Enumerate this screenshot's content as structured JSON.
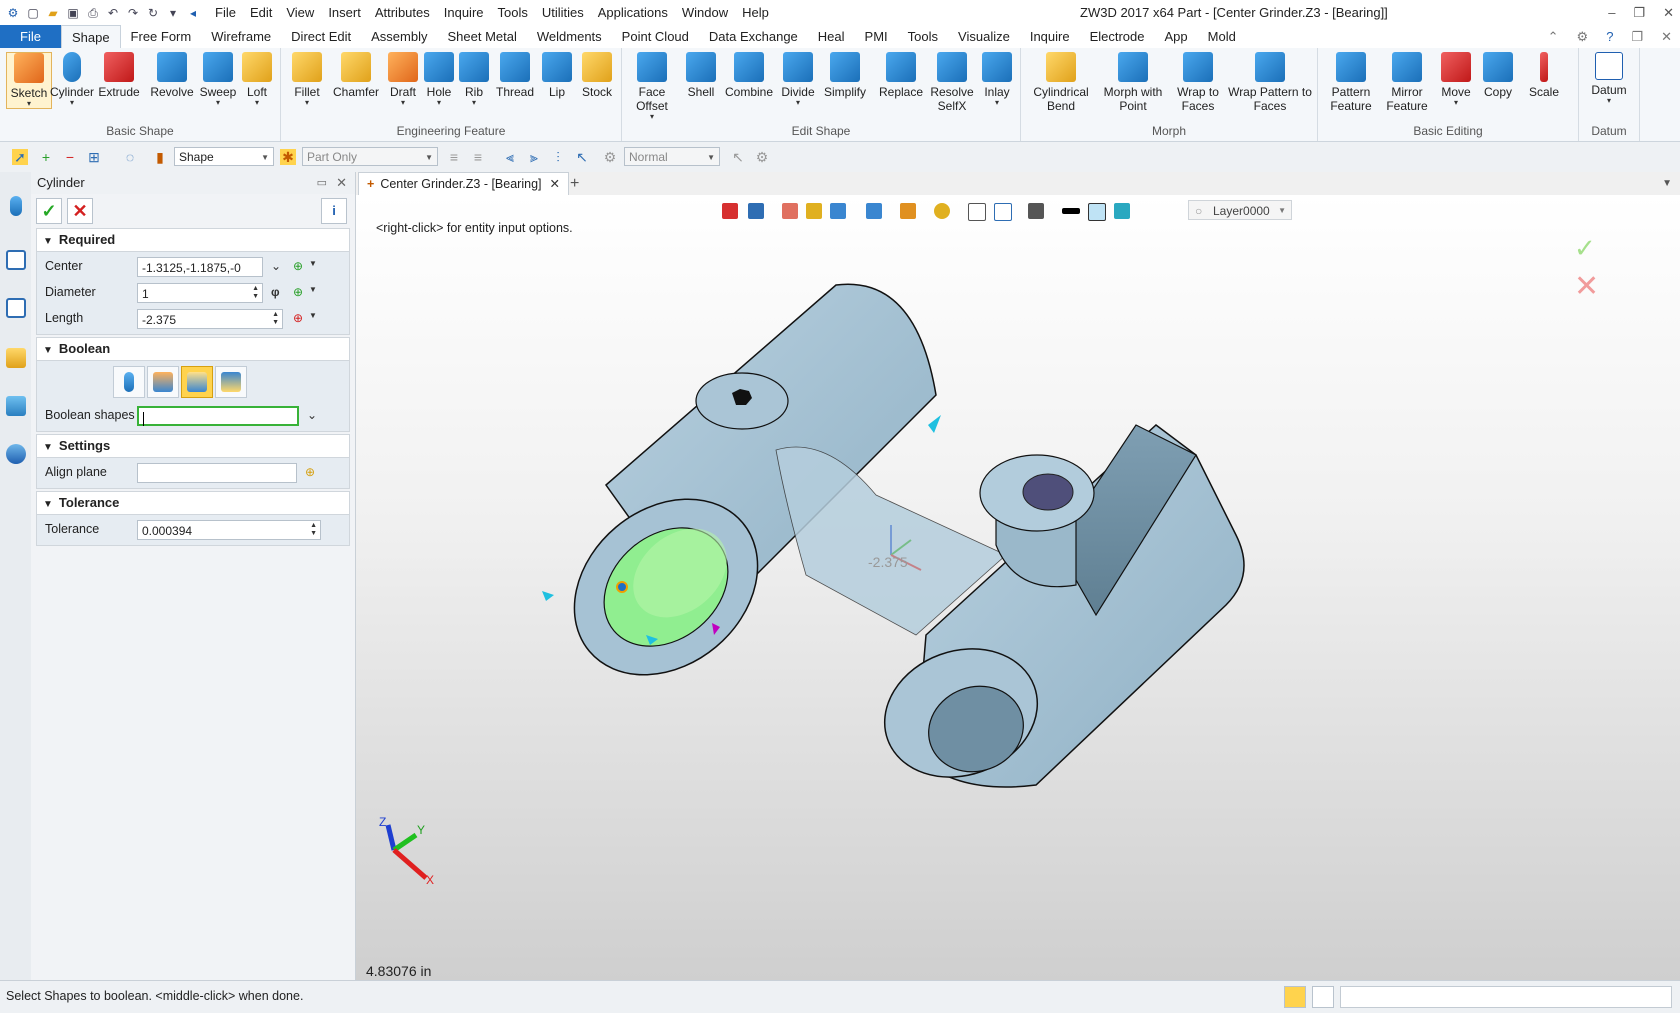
{
  "titlebar": {
    "menus": [
      "File",
      "Edit",
      "View",
      "Insert",
      "Attributes",
      "Inquire",
      "Tools",
      "Utilities",
      "Applications",
      "Window",
      "Help"
    ],
    "app_title": "ZW3D 2017  x64        Part - [Center Grinder.Z3 - [Bearing]]"
  },
  "ribbon_tabs": [
    "File",
    "Shape",
    "Free Form",
    "Wireframe",
    "Direct Edit",
    "Assembly",
    "Sheet Metal",
    "Weldments",
    "Point Cloud",
    "Data Exchange",
    "Heal",
    "PMI",
    "Tools",
    "Visualize",
    "Inquire",
    "Electrode",
    "App",
    "Mold"
  ],
  "ribbon": {
    "basic_shape": {
      "label": "Basic Shape",
      "items": [
        "Sketch",
        "Cylinder",
        "Extrude",
        "Revolve",
        "Sweep",
        "Loft"
      ]
    },
    "engineering": {
      "label": "Engineering Feature",
      "items": [
        "Fillet",
        "Chamfer",
        "Draft",
        "Hole",
        "Rib",
        "Thread",
        "Lip",
        "Stock"
      ]
    },
    "edit_shape": {
      "label": "Edit Shape",
      "items": [
        "Face Offset",
        "Shell",
        "Combine",
        "Divide",
        "Simplify",
        "Replace",
        "Resolve SelfX",
        "Inlay"
      ]
    },
    "morph": {
      "label": "Morph",
      "items": [
        "Cylindrical Bend",
        "Morph with Point",
        "Wrap to Faces",
        "Wrap Pattern to Faces"
      ]
    },
    "basic_editing": {
      "label": "Basic Editing",
      "items": [
        "Pattern Feature",
        "Mirror Feature",
        "Move",
        "Copy",
        "Scale"
      ]
    },
    "datum": {
      "label": "Datum",
      "items": [
        "Datum"
      ]
    }
  },
  "toolbar2": {
    "filter": "Shape",
    "scope": "Part Only",
    "mode": "Normal"
  },
  "panel": {
    "title": "Cylinder",
    "required": {
      "label": "Required",
      "center_label": "Center",
      "center_value": "-1.3125,-1.1875,-0",
      "diameter_label": "Diameter",
      "diameter_value": "1",
      "length_label": "Length",
      "length_value": "-2.375"
    },
    "boolean": {
      "label": "Boolean",
      "shapes_label": "Boolean shapes",
      "shapes_value": ""
    },
    "settings": {
      "label": "Settings",
      "align_label": "Align plane",
      "align_value": ""
    },
    "tolerance": {
      "label": "Tolerance",
      "tol_label": "Tolerance",
      "tol_value": "0.000394"
    }
  },
  "doc_tab": "Center Grinder.Z3 - [Bearing]",
  "viewport": {
    "hint": "<right-click> for entity input options.",
    "measure": "4.83076 in",
    "dim_label": "-2.375",
    "layer": "Layer0000",
    "triad": {
      "x": "X",
      "y": "Y",
      "z": "Z"
    }
  },
  "status": {
    "text": "Select Shapes to boolean.  <middle-click> when done."
  }
}
